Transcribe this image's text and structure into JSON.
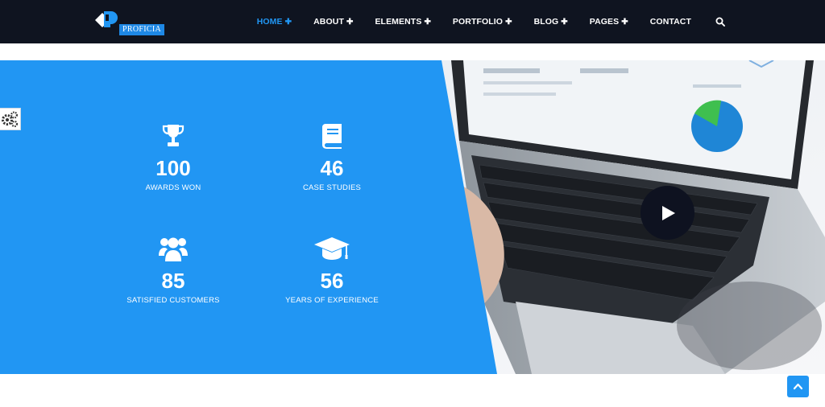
{
  "brand": {
    "name": "PROFICIA"
  },
  "nav": {
    "items": [
      {
        "label": "HOME",
        "plus": "✚"
      },
      {
        "label": "ABOUT",
        "plus": "✚"
      },
      {
        "label": "ELEMENTS",
        "plus": "✚"
      },
      {
        "label": "PORTFOLIO",
        "plus": "✚"
      },
      {
        "label": "BLOG",
        "plus": "✚"
      },
      {
        "label": "PAGES",
        "plus": "✚"
      },
      {
        "label": "CONTACT",
        "plus": ""
      }
    ],
    "active": "HOME"
  },
  "stats": [
    {
      "icon": "trophy-icon",
      "value": "100",
      "label": "AWARDS WON"
    },
    {
      "icon": "book-icon",
      "value": "46",
      "label": "CASE STUDIES"
    },
    {
      "icon": "users-icon",
      "value": "85",
      "label": "SATISFIED CUSTOMERS"
    },
    {
      "icon": "graduation-cap-icon",
      "value": "56",
      "label": "YEARS OF EXPERIENCE"
    }
  ],
  "colors": {
    "navbar": "#0f1420",
    "accent": "#2196f3",
    "panel": "#2196f3",
    "text_light": "#ffffff"
  }
}
